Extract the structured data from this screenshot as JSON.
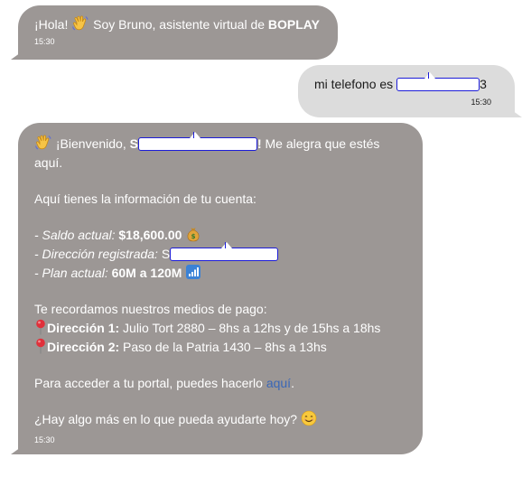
{
  "messages": [
    {
      "sender": "bot",
      "greeting": "¡Hola!",
      "text": " Soy Bruno, asistente virtual de ",
      "brand": "BOPLAY",
      "time": "15:30"
    },
    {
      "sender": "user",
      "text": "mi telefono es ",
      "text_suffix": "3",
      "time": "15:30"
    },
    {
      "sender": "bot",
      "welcome_prefix": " ¡Bienvenido, ",
      "welcome_name_initial": "S",
      "welcome_name_suffix": "!",
      "welcome_rest": " Me alegra que estés",
      "welcome_line2": "aquí.",
      "info_intro": "Aquí tienes la información de tu cuenta:",
      "balance_label": "- Saldo actual:",
      "balance_value": "$18,600.00",
      "address_label": "- Dirección registrada:",
      "address_initial": " S",
      "plan_label": "- Plan actual:",
      "plan_value": "60M a 120M",
      "payment_intro": "Te recordamos nuestros medios de pago:",
      "payment_1_label": "Dirección 1:",
      "payment_1_text": " Julio Tort 2880 – 8hs a 12hs y de 15hs a 18hs",
      "payment_2_label": "Dirección 2:",
      "payment_2_text": " Paso de la Patria 1430 – 8hs a 13hs",
      "portal_text": "Para acceder a tu portal, puedes hacerlo ",
      "portal_link": "aquí",
      "portal_end": ".",
      "closing": "¿Hay algo más en lo que pueda ayudarte hoy? ",
      "time": "15:30"
    }
  ],
  "colors": {
    "bot_bubble": "#9c9795",
    "user_bubble": "#dcdcdc",
    "link": "#3a67b7",
    "redaction_border": "#1c1cd8"
  },
  "icons": [
    "waving-hand-icon",
    "money-bag-icon",
    "signal-bars-icon",
    "round-pushpin-icon",
    "smiling-face-icon"
  ]
}
